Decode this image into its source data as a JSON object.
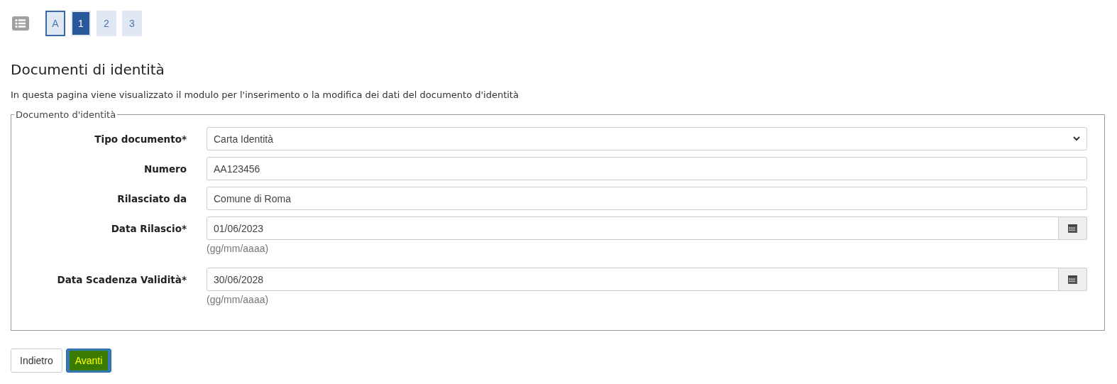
{
  "steps": [
    {
      "label": "A",
      "kind": "summary",
      "selected": false
    },
    {
      "label": "1",
      "kind": "step",
      "selected": true
    },
    {
      "label": "2",
      "kind": "step",
      "selected": false
    },
    {
      "label": "3",
      "kind": "step",
      "selected": false
    }
  ],
  "title": "Documenti di identità",
  "description": "In questa pagina viene visualizzato il modulo per l'inserimento o la modifica dei dati del documento d'identità",
  "fieldset": {
    "legend": "Documento d'identità",
    "fields": [
      {
        "label": "Tipo documento*",
        "kind": "select",
        "value": "Carta Identità"
      },
      {
        "label": "Numero",
        "kind": "text",
        "value": "AA123456"
      },
      {
        "label": "Rilasciato da",
        "kind": "text",
        "value": "Comune di Roma"
      },
      {
        "label": "Data Rilascio*",
        "kind": "date",
        "value": "01/06/2023",
        "hint": "(gg/mm/aaaa)"
      },
      {
        "label": "Data Scadenza Validità*",
        "kind": "date",
        "value": "30/06/2028",
        "hint": "(gg/mm/aaaa)"
      }
    ]
  },
  "buttons": [
    {
      "label": "Indietro",
      "kind": "default"
    },
    {
      "label": "Avanti",
      "kind": "primary"
    }
  ]
}
